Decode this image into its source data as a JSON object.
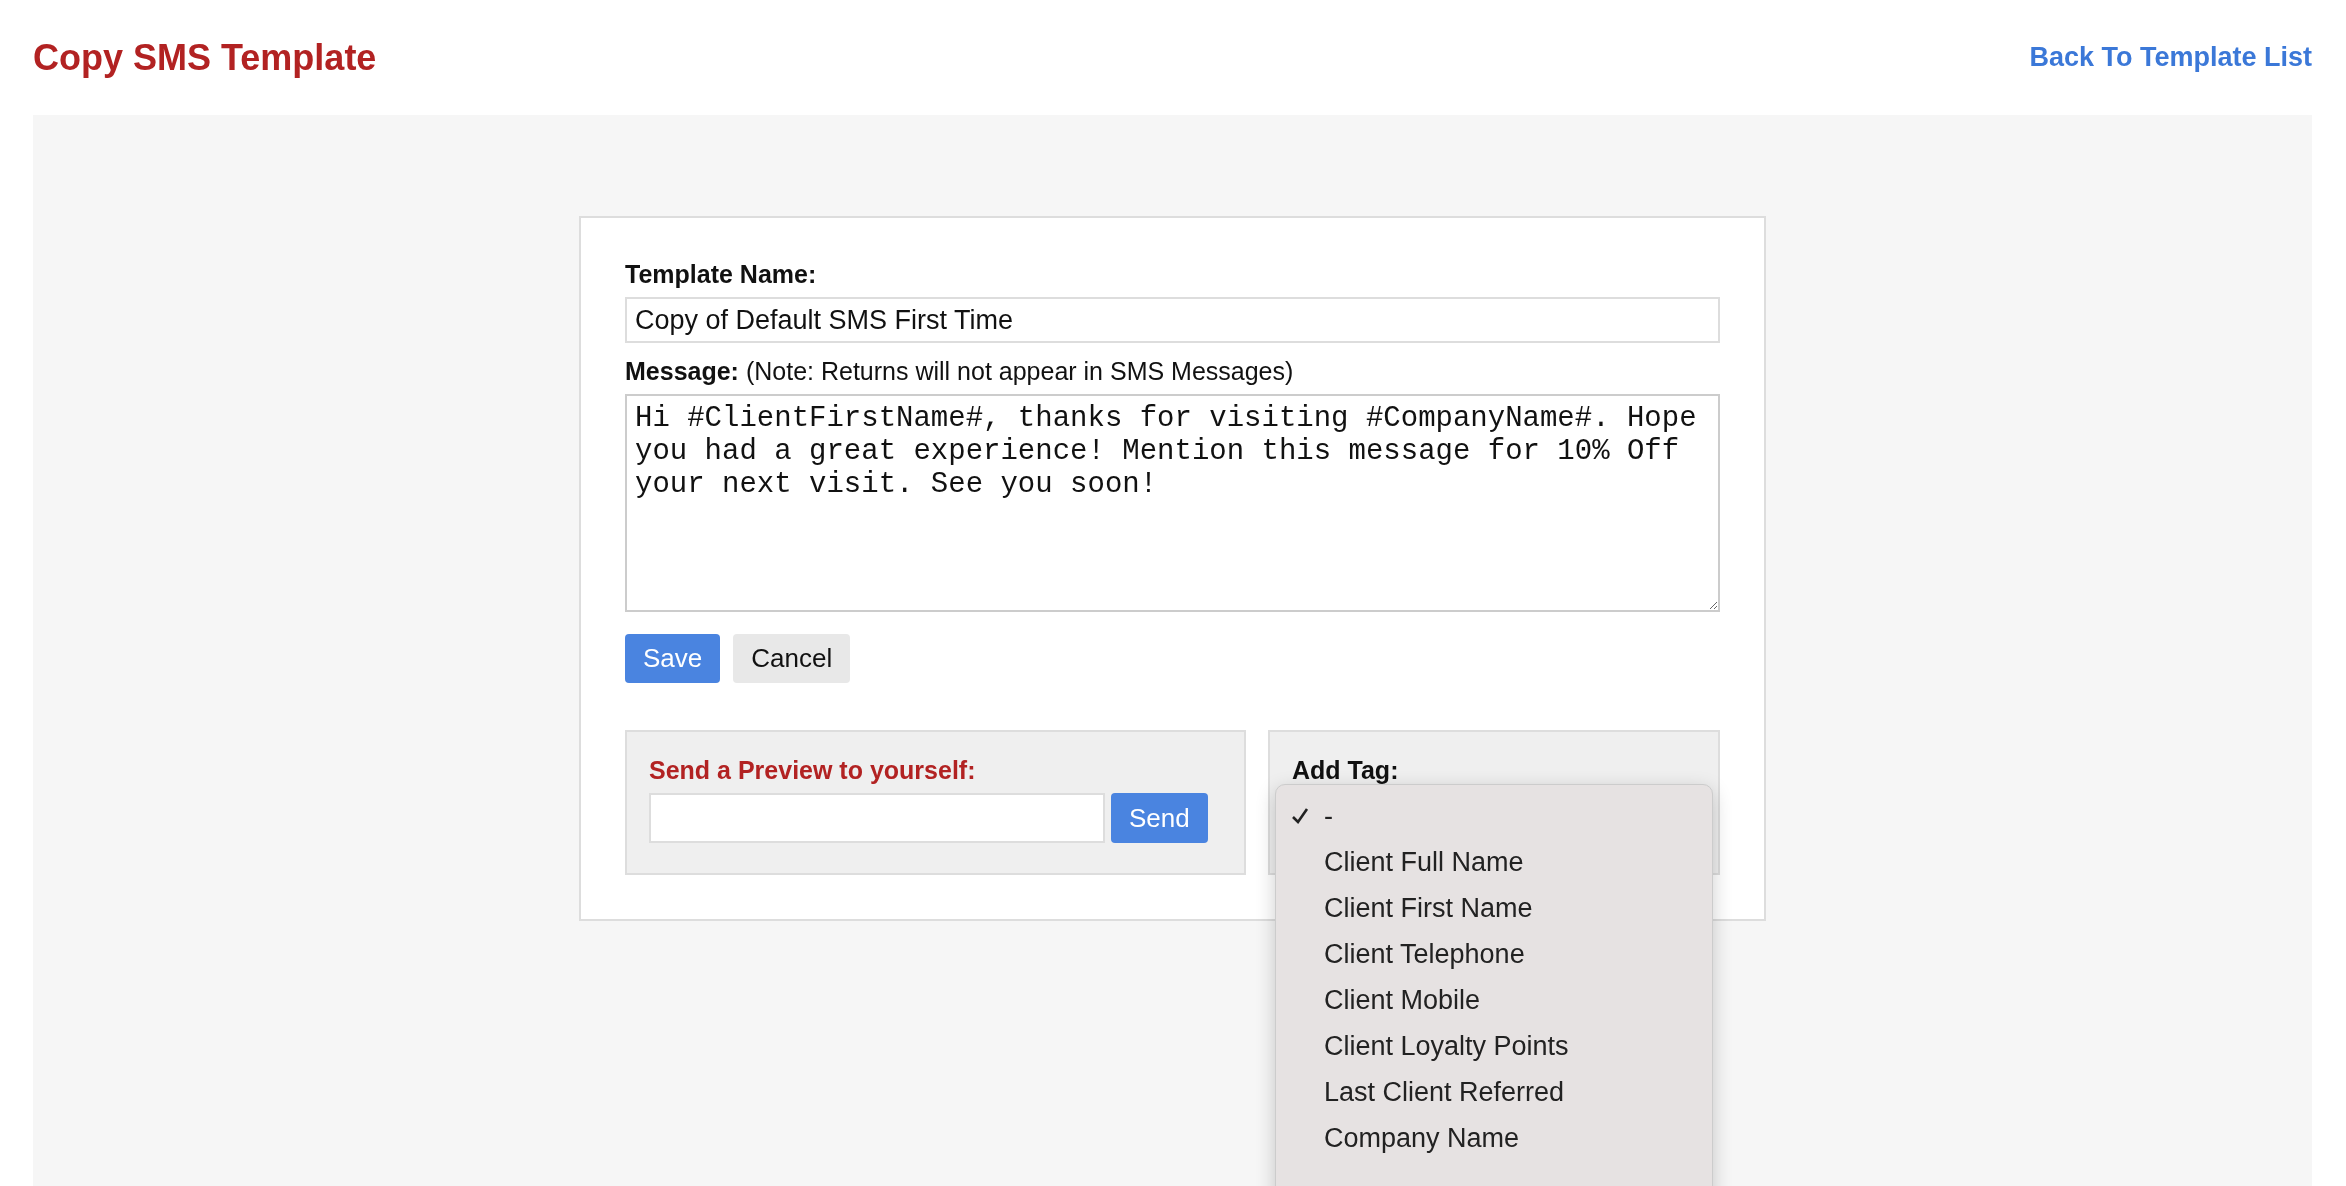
{
  "header": {
    "title": "Copy SMS Template",
    "back_link": "Back To Template List"
  },
  "form": {
    "name_label": "Template Name:",
    "name_value": "Copy of Default SMS First Time",
    "message_label": "Message:",
    "message_note": "(Note: Returns will not appear in SMS Messages)",
    "message_value": "Hi #ClientFirstName#, thanks for visiting #CompanyName#. Hope you had a great experience! Mention this message for 10% Off your next visit. See you soon!",
    "buttons": [
      {
        "label": "Save",
        "kind": "primary"
      },
      {
        "label": "Cancel",
        "kind": "secondary"
      }
    ]
  },
  "preview": {
    "title": "Send a Preview to yourself:",
    "button": "Send"
  },
  "add_tag": {
    "label": "Add Tag:",
    "options": [
      {
        "label": "-",
        "selected": true
      },
      {
        "label": "Client Full Name",
        "selected": false
      },
      {
        "label": "Client First Name",
        "selected": false
      },
      {
        "label": "Client Telephone",
        "selected": false
      },
      {
        "label": "Client Mobile",
        "selected": false
      },
      {
        "label": "Client Loyalty Points",
        "selected": false
      },
      {
        "label": "Last Client Referred",
        "selected": false
      },
      {
        "label": "Company Name",
        "selected": false
      }
    ]
  }
}
